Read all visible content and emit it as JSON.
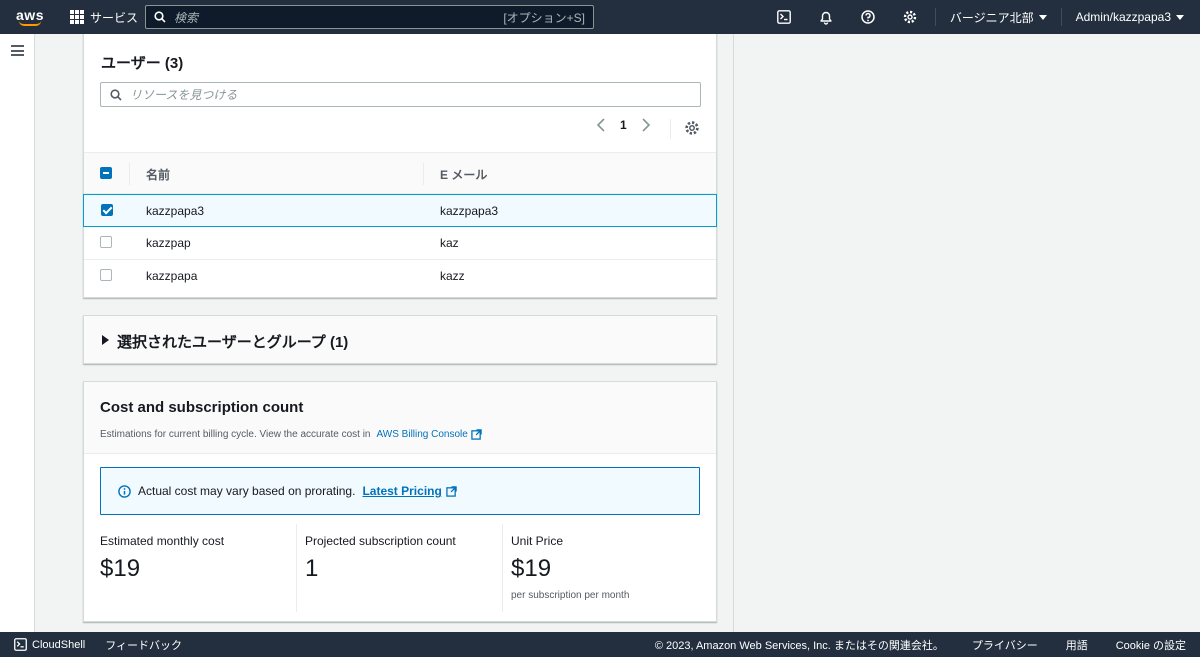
{
  "topnav": {
    "logo_text": "aws",
    "services_label": "サービス",
    "search_placeholder": "検索",
    "search_shortcut": "[オプション+S]",
    "region_label": "バージニア北部",
    "account_label": "Admin/kazzpapa3",
    "icons": [
      "cloudshell-icon",
      "notifications-bell-icon",
      "help-icon",
      "settings-gear-icon"
    ]
  },
  "users": {
    "title": "ユーザー (3)",
    "filter_placeholder": "リソースを見つける",
    "current_page": "1",
    "columns": [
      "名前",
      "E メール"
    ],
    "rows": [
      {
        "name": "kazzpapa3",
        "email": "kazzpapa3",
        "checked": true
      },
      {
        "name": "kazzpap",
        "email": "kaz",
        "checked": false
      },
      {
        "name": "kazzpapa",
        "email": "kazz",
        "checked": false
      }
    ]
  },
  "selected_section": {
    "title": "選択されたユーザーとグループ (1)"
  },
  "cost": {
    "title": "Cost and subscription count",
    "description_prefix": "Estimations for current billing cycle. View the accurate cost in",
    "billing_link": "AWS Billing Console",
    "alert_text": "Actual cost may vary based on prorating.",
    "alert_link": "Latest Pricing",
    "metrics": [
      {
        "label": "Estimated monthly cost",
        "value": "$19",
        "sub": ""
      },
      {
        "label": "Projected subscription count",
        "value": "1",
        "sub": ""
      },
      {
        "label": "Unit Price",
        "value": "$19",
        "sub": "per subscription per month"
      }
    ]
  },
  "footer": {
    "cloudshell": "CloudShell",
    "feedback": "フィードバック",
    "copyright": "© 2023, Amazon Web Services, Inc. またはその関連会社。",
    "privacy": "プライバシー",
    "terms": "用語",
    "cookie": "Cookie の設定"
  },
  "colors": {
    "nav_bg": "#232f3e",
    "accent": "#ff9900",
    "link": "#0073bb",
    "selected_row_border": "#00a1c9"
  }
}
